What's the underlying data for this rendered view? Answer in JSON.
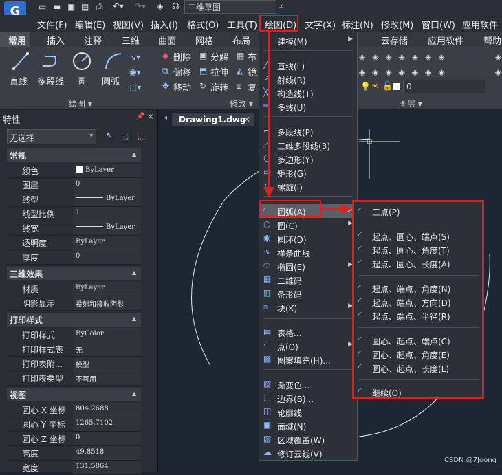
{
  "quick_access": {
    "workspace": "二维草图"
  },
  "menubar": {
    "items": [
      "文件(F)",
      "编辑(E)",
      "视图(V)",
      "插入(I)",
      "格式(O)",
      "工具(T)",
      "绘图(D)",
      "文字(X)",
      "标注(N)",
      "修改(M)",
      "窗口(W)",
      "应用软件"
    ]
  },
  "ribbon_tabs": [
    "常用",
    "插入",
    "注释",
    "三维",
    "曲面",
    "网格",
    "布局",
    "云存储",
    "应用软件",
    "帮助"
  ],
  "ribbon": {
    "draw_tools": [
      "直线",
      "多段线",
      "圆",
      "圆弧"
    ],
    "draw_group": "绘图 ▾",
    "modify_tools": [
      "删除",
      "分解",
      "偏移",
      "拉伸",
      "移动",
      "旋转"
    ],
    "modify_partial": [
      "布",
      "镜",
      "复"
    ],
    "modify_group": "修改 ▾",
    "layer_group": "图层 ▾",
    "layer_value": "0"
  },
  "properties": {
    "title": "特性",
    "selection": "无选择",
    "sections": [
      {
        "name": "常规",
        "rows": [
          [
            "颜色",
            "ByLayer"
          ],
          [
            "图层",
            "0"
          ],
          [
            "线型",
            "ByLayer"
          ],
          [
            "线型比例",
            "1"
          ],
          [
            "线宽",
            "ByLayer"
          ],
          [
            "透明度",
            "ByLayer"
          ],
          [
            "厚度",
            "0"
          ]
        ]
      },
      {
        "name": "三维效果",
        "rows": [
          [
            "材质",
            "ByLayer"
          ],
          [
            "阴影显示",
            "投射和接收阴影"
          ]
        ]
      },
      {
        "name": "打印样式",
        "rows": [
          [
            "打印样式",
            "ByColor"
          ],
          [
            "打印样式表",
            "无"
          ],
          [
            "打印表附...",
            "模型"
          ],
          [
            "打印表类型",
            "不可用"
          ]
        ]
      },
      {
        "name": "视图",
        "rows": [
          [
            "圆心 X 坐标",
            "804.2688"
          ],
          [
            "圆心 Y 坐标",
            "1265.7102"
          ],
          [
            "圆心 Z 坐标",
            "0"
          ],
          [
            "高度",
            "49.8518"
          ],
          [
            "宽度",
            "131.5864"
          ]
        ]
      }
    ]
  },
  "drawing_tab": "Drawing1.dwg",
  "draw_menu": {
    "items": [
      {
        "label": "建模(M)",
        "sub": true
      },
      {
        "label": "直线(L)"
      },
      {
        "label": "射线(R)"
      },
      {
        "label": "构造线(T)"
      },
      {
        "label": "多线(U)"
      },
      {
        "label": "多段线(P)"
      },
      {
        "label": "三维多段线(3)"
      },
      {
        "label": "多边形(Y)"
      },
      {
        "label": "矩形(G)"
      },
      {
        "label": "螺旋(I)"
      },
      {
        "label": "圆弧(A)",
        "sub": true
      },
      {
        "label": "圆(C)",
        "sub": true
      },
      {
        "label": "圆环(D)"
      },
      {
        "label": "样条曲线"
      },
      {
        "label": "椭圆(E)",
        "sub": true
      },
      {
        "label": "二维码"
      },
      {
        "label": "条形码"
      },
      {
        "label": "块(K)",
        "sub": true
      },
      {
        "label": "表格..."
      },
      {
        "label": "点(O)",
        "sub": true
      },
      {
        "label": "图案填充(H)..."
      },
      {
        "label": "渐变色..."
      },
      {
        "label": "边界(B)..."
      },
      {
        "label": "轮廓线"
      },
      {
        "label": "面域(N)"
      },
      {
        "label": "区域覆盖(W)"
      },
      {
        "label": "修订云线(V)"
      }
    ]
  },
  "arc_menu": {
    "items": [
      "三点(P)",
      "起点、圆心、端点(S)",
      "起点、圆心、角度(T)",
      "起点、圆心、长度(A)",
      "起点、端点、角度(N)",
      "起点、端点、方向(D)",
      "起点、端点、半径(R)",
      "圆心、起点、端点(C)",
      "圆心、起点、角度(E)",
      "圆心、起点、长度(L)",
      "继续(O)"
    ]
  },
  "watermark": "CSDN @7Joong",
  "colors": {
    "highlight": "#e02020",
    "accent": "#8fb8ff"
  }
}
